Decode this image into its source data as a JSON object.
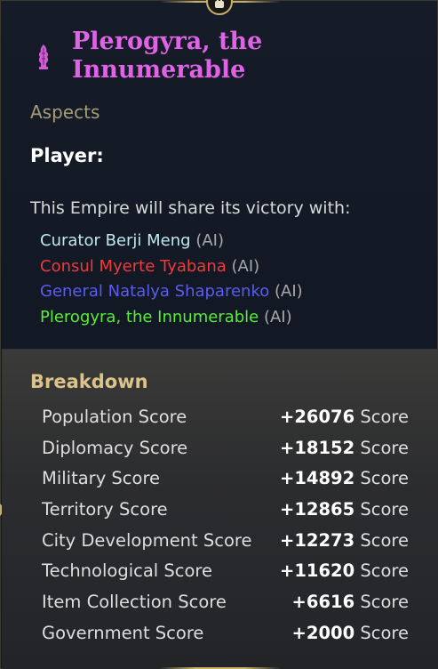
{
  "empire": {
    "title": "Plerogyra, the Innumerable",
    "emblem_icon": "coral-emblem-icon",
    "title_color": "#e063e6"
  },
  "aspects_label": "Aspects",
  "player_label": "Player:",
  "share_text": "This Empire will share its victory with:",
  "allies": [
    {
      "name": "Curator Berji Meng",
      "tag": "(AI)",
      "color": "#bde9f0"
    },
    {
      "name": "Consul Myerte Tyabana",
      "tag": "(AI)",
      "color": "#ef3a3a"
    },
    {
      "name": "General Natalya Shaparenko",
      "tag": "(AI)",
      "color": "#5a5cf0"
    },
    {
      "name": "Plerogyra, the Innumerable",
      "tag": "(AI)",
      "color": "#59ec3e"
    }
  ],
  "breakdown": {
    "title": "Breakdown",
    "rows": [
      {
        "label": "Population Score",
        "value": "+26076",
        "unit": "Score"
      },
      {
        "label": "Diplomacy Score",
        "value": "+18152",
        "unit": "Score"
      },
      {
        "label": "Military Score",
        "value": "+14892",
        "unit": "Score"
      },
      {
        "label": "Territory Score",
        "value": "+12865",
        "unit": "Score"
      },
      {
        "label": "City Development Score",
        "value": "+12273",
        "unit": "Score"
      },
      {
        "label": "Technological Score",
        "value": "+11620",
        "unit": "Score"
      },
      {
        "label": "Item Collection Score",
        "value": "+6616",
        "unit": "Score"
      },
      {
        "label": "Government Score",
        "value": "+2000",
        "unit": "Score"
      }
    ]
  },
  "colors": {
    "gold_accent": "#c9b06a",
    "breakdown_title": "#dcc389",
    "aspects": "#a79c7a"
  }
}
